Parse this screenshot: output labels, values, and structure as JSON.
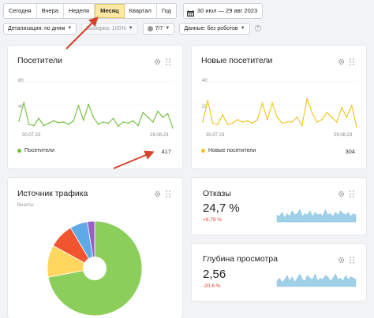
{
  "toolbar": {
    "periods": [
      {
        "label": "Сегодня",
        "active": false
      },
      {
        "label": "Вчера",
        "active": false
      },
      {
        "label": "Неделя",
        "active": false
      },
      {
        "label": "Месяц",
        "active": true
      },
      {
        "label": "Квартал",
        "active": false
      },
      {
        "label": "Год",
        "active": false
      }
    ],
    "date_range": "30 июл — 29 авг 2023"
  },
  "filters": {
    "detail": "Детализация: по дням",
    "sample": "Выборка: 100%",
    "segments": "7/7",
    "data": "Данные: без роботов"
  },
  "visitors": {
    "title": "Посетители",
    "y_max_label": "80",
    "y_mid_label": "40",
    "x_start": "30.07.23",
    "x_end": "29.08.23",
    "legend": "Посетители",
    "total": "417",
    "color": "#6fbf3b"
  },
  "new_visitors": {
    "title": "Новые посетители",
    "y_max_label": "40",
    "y_mid_label": "20",
    "x_start": "30.07.23",
    "x_end": "29.08.23",
    "legend": "Новые посетители",
    "total": "304",
    "color": "#f2c21b"
  },
  "traffic": {
    "title": "Источник трафика",
    "subtitle": "Визиты"
  },
  "bounce": {
    "title": "Отказы",
    "value": "24,7 %",
    "delta": "+9,79 %"
  },
  "depth": {
    "title": "Глубина просмотра",
    "value": "2,56",
    "delta": "-20,6 %"
  },
  "chart_data": [
    {
      "type": "line",
      "series": [
        {
          "name": "Посетители",
          "values": [
            14,
            45,
            8,
            6,
            18,
            6,
            10,
            14,
            11,
            12,
            8,
            14,
            40,
            15,
            42,
            20,
            8,
            12,
            10,
            18,
            5,
            12,
            10,
            14,
            6,
            28,
            20,
            12,
            30,
            20,
            26,
            2
          ]
        }
      ],
      "ylim": [
        0,
        80
      ],
      "color": "#6fbf3b"
    },
    {
      "type": "line",
      "series": [
        {
          "name": "Новые посетители",
          "values": [
            6,
            24,
            5,
            4,
            12,
            4,
            5,
            8,
            6,
            7,
            5,
            8,
            22,
            8,
            22,
            10,
            5,
            6,
            6,
            10,
            3,
            26,
            14,
            6,
            8,
            14,
            10,
            6,
            18,
            10,
            20,
            2
          ]
        }
      ],
      "ylim": [
        0,
        40
      ],
      "color": "#f2c21b"
    },
    {
      "type": "pie",
      "categories": [
        "green",
        "yellow",
        "red",
        "blue",
        "purple"
      ],
      "values": [
        72,
        11,
        8.5,
        6,
        2.5
      ],
      "colors": [
        "#8bcf5a",
        "#ffd75e",
        "#f0552f",
        "#5fa9e6",
        "#9a5ec8"
      ]
    }
  ],
  "sparklines": {
    "bounce": [
      5,
      4,
      7,
      3,
      6,
      4,
      8,
      5,
      6,
      9,
      4,
      6,
      5,
      8,
      4,
      7,
      5,
      6,
      4,
      9,
      5,
      6,
      4,
      7,
      5,
      8,
      6,
      5,
      7,
      4,
      6,
      5
    ],
    "depth": [
      4,
      6,
      3,
      5,
      8,
      4,
      7,
      3,
      6,
      9,
      5,
      4,
      8,
      6,
      5,
      9,
      4,
      6,
      5,
      8,
      7,
      4,
      6,
      9,
      5,
      6,
      4,
      8,
      5,
      7,
      6,
      5
    ],
    "color": "#9fd0e8"
  },
  "annotation_color": "#d5432a"
}
